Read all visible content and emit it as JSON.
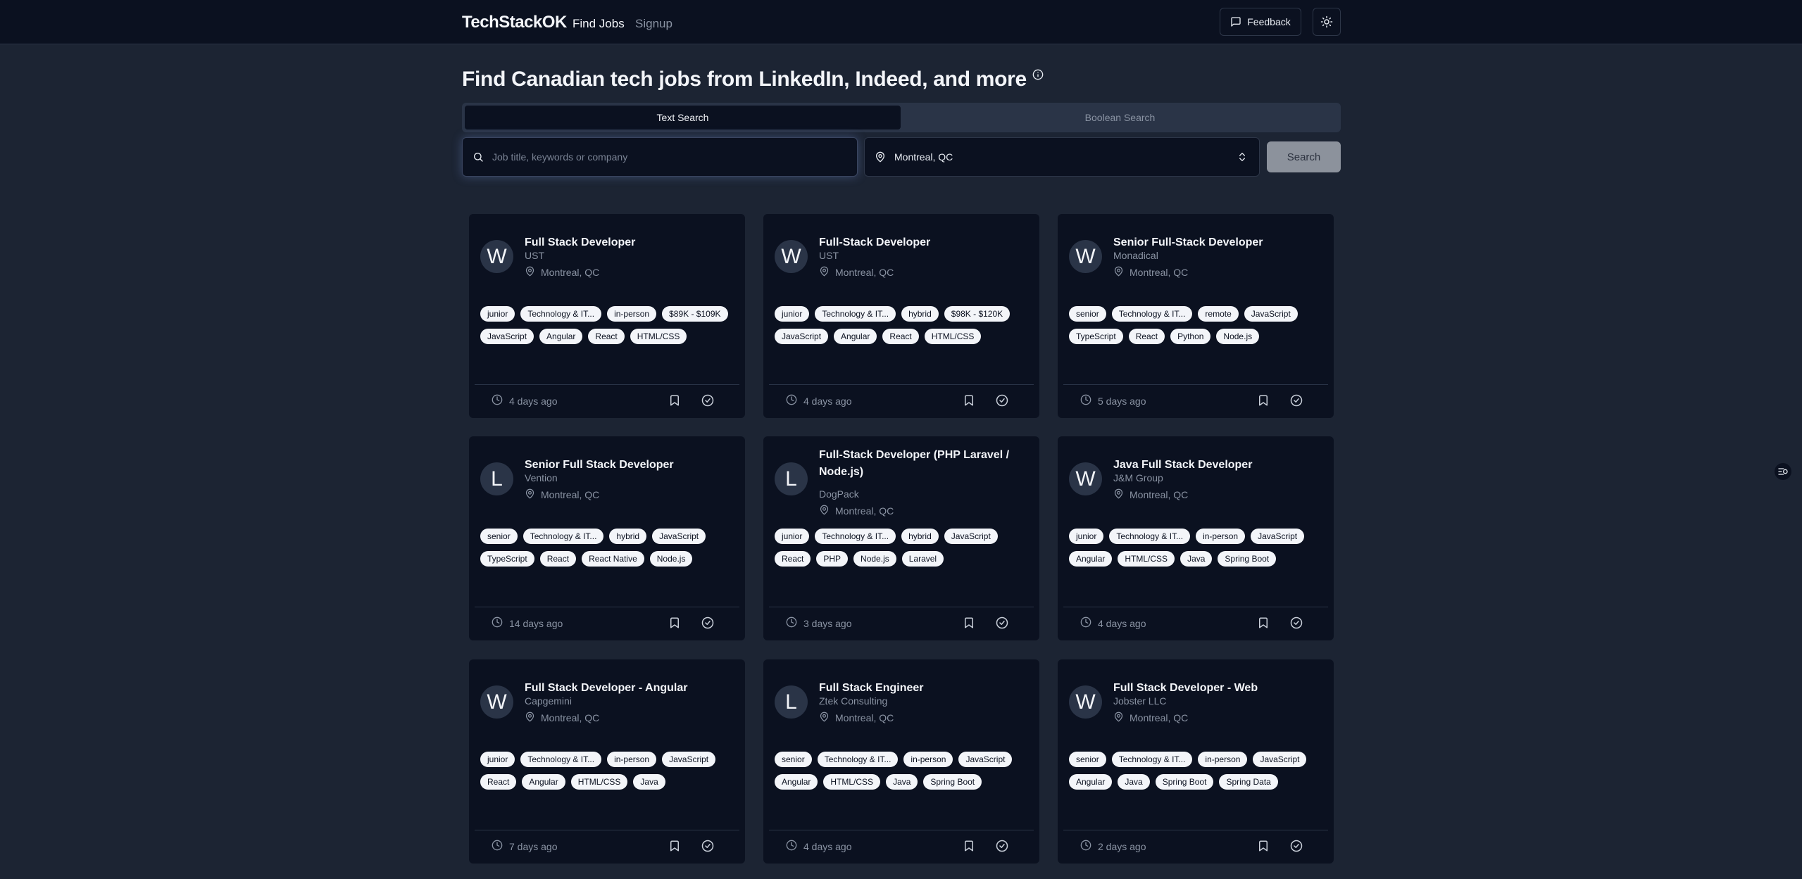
{
  "nav": {
    "brand": "TechStackOK",
    "find_jobs": "Find Jobs",
    "signup": "Signup",
    "feedback": "Feedback"
  },
  "heading": "Find Canadian tech jobs from LinkedIn, Indeed, and more",
  "tabs": {
    "text_search": "Text Search",
    "boolean_search": "Boolean Search"
  },
  "search": {
    "placeholder": "Job title, keywords or company",
    "value": "",
    "location": "Montreal, QC",
    "button": "Search"
  },
  "jobs": [
    {
      "initial": "W",
      "title": "Full Stack Developer",
      "company": "UST",
      "location": "Montreal, QC",
      "tags": [
        "junior",
        "Technology & IT...",
        "in-person",
        "$89K - $109K",
        "JavaScript",
        "Angular",
        "React",
        "HTML/CSS"
      ],
      "posted": "4 days ago"
    },
    {
      "initial": "W",
      "title": "Full-Stack Developer",
      "company": "UST",
      "location": "Montreal, QC",
      "tags": [
        "junior",
        "Technology & IT...",
        "hybrid",
        "$98K - $120K",
        "JavaScript",
        "Angular",
        "React",
        "HTML/CSS"
      ],
      "posted": "4 days ago"
    },
    {
      "initial": "W",
      "title": "Senior Full-Stack Developer",
      "company": "Monadical",
      "location": "Montreal, QC",
      "tags": [
        "senior",
        "Technology & IT...",
        "remote",
        "JavaScript",
        "TypeScript",
        "React",
        "Python",
        "Node.js"
      ],
      "posted": "5 days ago"
    },
    {
      "initial": "L",
      "title": "Senior Full Stack Developer",
      "company": "Vention",
      "location": "Montreal, QC",
      "tags": [
        "senior",
        "Technology & IT...",
        "hybrid",
        "JavaScript",
        "TypeScript",
        "React",
        "React Native",
        "Node.js"
      ],
      "posted": "14 days ago"
    },
    {
      "initial": "L",
      "title": "Full-Stack Developer (PHP Laravel / Node.js)",
      "company": "DogPack",
      "location": "Montreal, QC",
      "tags": [
        "junior",
        "Technology & IT...",
        "hybrid",
        "JavaScript",
        "React",
        "PHP",
        "Node.js",
        "Laravel"
      ],
      "posted": "3 days ago"
    },
    {
      "initial": "W",
      "title": "Java Full Stack Developer",
      "company": "J&M Group",
      "location": "Montreal, QC",
      "tags": [
        "junior",
        "Technology & IT...",
        "in-person",
        "JavaScript",
        "Angular",
        "HTML/CSS",
        "Java",
        "Spring Boot"
      ],
      "posted": "4 days ago"
    },
    {
      "initial": "W",
      "title": "Full Stack Developer - Angular",
      "company": "Capgemini",
      "location": "Montreal, QC",
      "tags": [
        "junior",
        "Technology & IT...",
        "in-person",
        "JavaScript",
        "React",
        "Angular",
        "HTML/CSS",
        "Java"
      ],
      "posted": "7 days ago"
    },
    {
      "initial": "L",
      "title": "Full Stack Engineer",
      "company": "Ztek Consulting",
      "location": "Montreal, QC",
      "tags": [
        "senior",
        "Technology & IT...",
        "in-person",
        "JavaScript",
        "Angular",
        "HTML/CSS",
        "Java",
        "Spring Boot"
      ],
      "posted": "4 days ago"
    },
    {
      "initial": "W",
      "title": "Full Stack Developer - Web",
      "company": "Jobster LLC",
      "location": "Montreal, QC",
      "tags": [
        "senior",
        "Technology & IT...",
        "in-person",
        "JavaScript",
        "Angular",
        "Java",
        "Spring Boot",
        "Spring Data"
      ],
      "posted": "2 days ago"
    }
  ]
}
